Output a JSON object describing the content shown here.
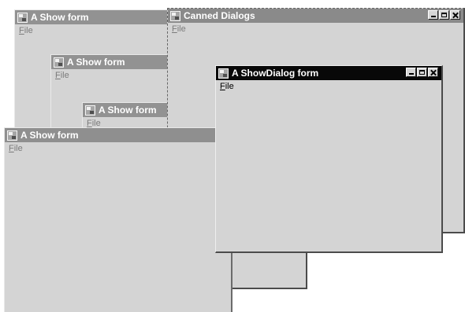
{
  "windows": {
    "show_form_1": {
      "title": "A Show form",
      "menu": {
        "file": {
          "mnemonic": "F",
          "rest": "ile"
        }
      }
    },
    "show_form_2": {
      "title": "A Show form",
      "menu": {
        "file": {
          "mnemonic": "F",
          "rest": "ile"
        }
      }
    },
    "show_form_3": {
      "title": "A Show form",
      "menu": {
        "file": {
          "mnemonic": "F",
          "rest": "ile"
        }
      }
    },
    "show_form_4": {
      "title": "A Show form",
      "menu": {
        "file": {
          "mnemonic": "F",
          "rest": "ile"
        }
      }
    },
    "canned_dialogs": {
      "title": "Canned Dialogs",
      "menu": {
        "file": {
          "mnemonic": "F",
          "rest": "ile"
        }
      }
    },
    "showdialog_form": {
      "title": "A ShowDialog form",
      "menu": {
        "file": {
          "mnemonic": "F",
          "rest": "ile"
        }
      }
    }
  },
  "icons": {
    "window_icon": "application-window-icon",
    "minimize": "minimize-icon",
    "maximize": "maximize-icon",
    "close": "close-icon"
  },
  "colors": {
    "desktop": "#ffffff",
    "window_face": "#d4d4d4",
    "active_title": "#080808",
    "inactive_title": "#909090",
    "text_inactive": "#7b7b7b",
    "text_active": "#000000"
  }
}
